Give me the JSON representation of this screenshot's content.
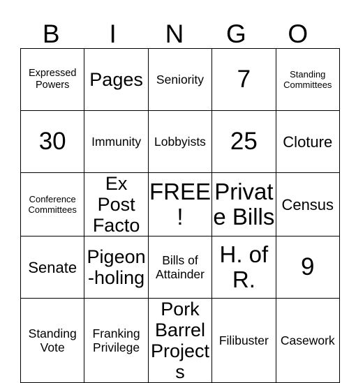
{
  "card": {
    "header_letters": [
      "B",
      "I",
      "N",
      "G",
      "O"
    ],
    "rows": [
      [
        {
          "text": "Expressed Powers",
          "size": "sm"
        },
        {
          "text": "Pages",
          "size": "xl"
        },
        {
          "text": "Seniority",
          "size": "md"
        },
        {
          "text": "7",
          "size": "num"
        },
        {
          "text": "Standing Committees",
          "size": "xs"
        }
      ],
      [
        {
          "text": "30",
          "size": "num"
        },
        {
          "text": "Immunity",
          "size": "md"
        },
        {
          "text": "Lobbyists",
          "size": "md"
        },
        {
          "text": "25",
          "size": "num"
        },
        {
          "text": "Cloture",
          "size": "lg"
        }
      ],
      [
        {
          "text": "Conference Committees",
          "size": "xs"
        },
        {
          "text": "Ex Post Facto",
          "size": "xl"
        },
        {
          "text": "FREE!",
          "size": "xxl"
        },
        {
          "text": "Private Bills",
          "size": "xxl"
        },
        {
          "text": "Census",
          "size": "lg"
        }
      ],
      [
        {
          "text": "Senate",
          "size": "lg"
        },
        {
          "text": "Pigeon-holing",
          "size": "xl"
        },
        {
          "text": "Bills of Attainder",
          "size": "md"
        },
        {
          "text": "H. of R.",
          "size": "xxl"
        },
        {
          "text": "9",
          "size": "num"
        }
      ],
      [
        {
          "text": "Standing Vote",
          "size": "md"
        },
        {
          "text": "Franking Privilege",
          "size": "md"
        },
        {
          "text": "Pork Barrel Projects",
          "size": "xl"
        },
        {
          "text": "Filibuster",
          "size": "md"
        },
        {
          "text": "Casework",
          "size": "md"
        }
      ]
    ]
  },
  "colors": {
    "border": "#000000",
    "text": "#000000",
    "background": "#ffffff"
  }
}
